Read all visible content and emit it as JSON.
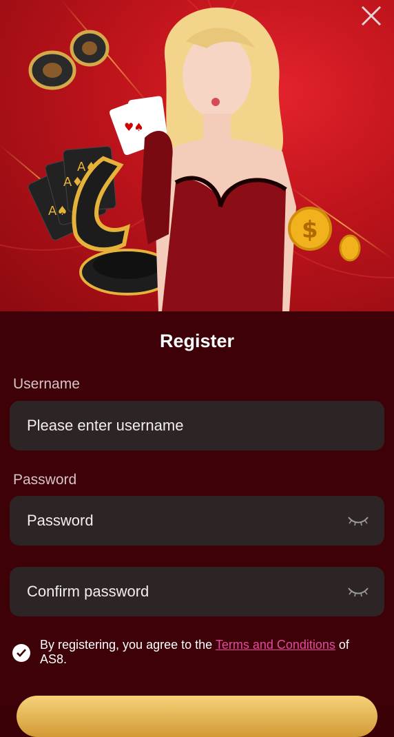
{
  "colors": {
    "panel_bg": "#3d0107",
    "field_bg": "#2d2425",
    "link": "#e64aa0",
    "hero_red": "#c0141c"
  },
  "hero": {
    "close_icon": "close-icon"
  },
  "form": {
    "title": "Register",
    "username_label": "Username",
    "username_placeholder": "Please enter username",
    "password_label": "Password",
    "password_placeholder": "Password",
    "confirm_placeholder": "Confirm password",
    "agree_prefix": "By registering, you agree to the ",
    "terms_link": "Terms and Conditions",
    "agree_suffix": " of AS8.",
    "agree_checked": true,
    "eye_icon": "eye-closed-icon"
  }
}
